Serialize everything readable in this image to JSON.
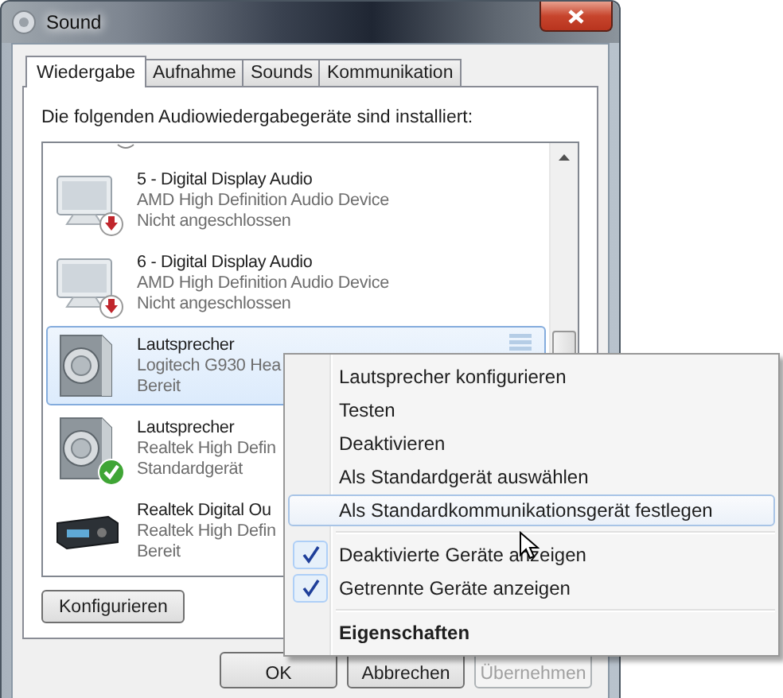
{
  "window": {
    "title": "Sound"
  },
  "tabs": [
    {
      "label": "Wiedergabe",
      "selected": true
    },
    {
      "label": "Aufnahme",
      "selected": false
    },
    {
      "label": "Sounds",
      "selected": false
    },
    {
      "label": "Kommunikation",
      "selected": false
    }
  ],
  "intro": "Die folgenden Audiowiedergabegeräte sind installiert:",
  "devices": [
    {
      "kind": "display",
      "unplugged": true,
      "default": false,
      "name": "5 - Digital Display Audio",
      "driver": "AMD High Definition Audio Device",
      "status": "Nicht angeschlossen",
      "selected": false
    },
    {
      "kind": "display",
      "unplugged": true,
      "default": false,
      "name": "6 - Digital Display Audio",
      "driver": "AMD High Definition Audio Device",
      "status": "Nicht angeschlossen",
      "selected": false
    },
    {
      "kind": "speaker",
      "unplugged": false,
      "default": false,
      "name": "Lautsprecher",
      "driver": "Logitech G930 Hea",
      "status": "Bereit",
      "selected": true
    },
    {
      "kind": "speaker",
      "unplugged": false,
      "default": true,
      "name": "Lautsprecher",
      "driver": "Realtek High Defin",
      "status": "Standardgerät",
      "selected": false
    },
    {
      "kind": "receiver",
      "unplugged": false,
      "default": false,
      "name": "Realtek Digital Ou",
      "driver": "Realtek High Defin",
      "status": "Bereit",
      "selected": false
    }
  ],
  "configure_button": "Konfigurieren",
  "buttons": [
    {
      "label": "OK",
      "disabled": false
    },
    {
      "label": "Abbrechen",
      "disabled": false
    },
    {
      "label": "Übernehmen",
      "disabled": true
    }
  ],
  "context_menu": [
    {
      "kind": "item",
      "label": "Lautsprecher konfigurieren",
      "selected": false
    },
    {
      "kind": "item",
      "label": "Testen",
      "selected": false
    },
    {
      "kind": "item",
      "label": "Deaktivieren",
      "selected": false
    },
    {
      "kind": "item",
      "label": "Als Standardgerät auswählen",
      "selected": false
    },
    {
      "kind": "item",
      "label": "Als Standardkommunikationsgerät festlegen",
      "selected": true
    },
    {
      "kind": "separator"
    },
    {
      "kind": "check",
      "label": "Deaktivierte Geräte anzeigen",
      "checked": true,
      "selected": false
    },
    {
      "kind": "check",
      "label": "Getrennte Geräte anzeigen",
      "checked": true,
      "selected": false
    },
    {
      "kind": "separator"
    },
    {
      "kind": "default",
      "label": "Eigenschaften",
      "selected": false
    }
  ]
}
